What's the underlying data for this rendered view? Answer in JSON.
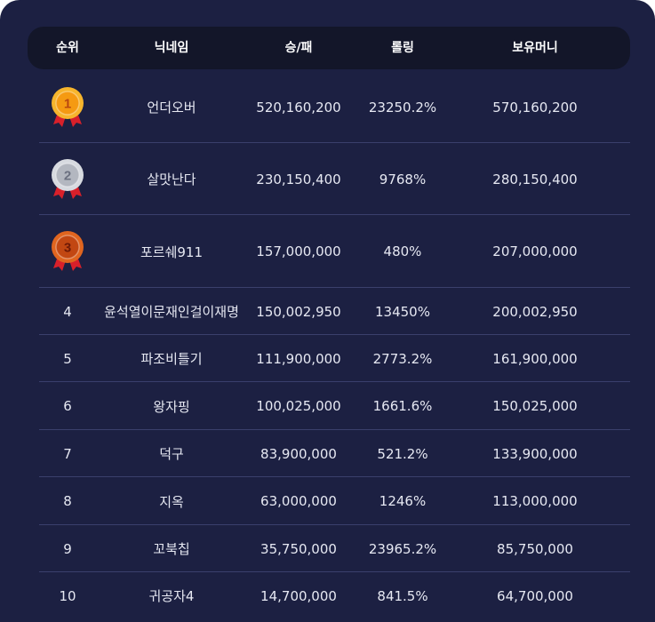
{
  "colors": {
    "panel": "#1c2042",
    "header": "#131629",
    "divider": "#3a3f6c",
    "text": "#e6e8f2",
    "gold": "#f5a623",
    "silver": "#c9ccd3",
    "bronze": "#d4561c",
    "ribbon": "#d8202a"
  },
  "table": {
    "headers": {
      "rank": "순위",
      "nickname": "닉네임",
      "win_loss": "승/패",
      "rolling": "롤링",
      "money": "보유머니"
    },
    "rows": [
      {
        "rank": "1",
        "medal": "gold-medal-icon",
        "nickname": "언더오버",
        "win_loss": "520,160,200",
        "rolling": "23250.2%",
        "money": "570,160,200"
      },
      {
        "rank": "2",
        "medal": "silver-medal-icon",
        "nickname": "살맛난다",
        "win_loss": "230,150,400",
        "rolling": "9768%",
        "money": "280,150,400"
      },
      {
        "rank": "3",
        "medal": "bronze-medal-icon",
        "nickname": "포르쉐911",
        "win_loss": "157,000,000",
        "rolling": "480%",
        "money": "207,000,000"
      },
      {
        "rank": "4",
        "nickname": "윤석열이문재인걸이재명",
        "win_loss": "150,002,950",
        "rolling": "13450%",
        "money": "200,002,950"
      },
      {
        "rank": "5",
        "nickname": "파조비틀기",
        "win_loss": "111,900,000",
        "rolling": "2773.2%",
        "money": "161,900,000"
      },
      {
        "rank": "6",
        "nickname": "왕자핑",
        "win_loss": "100,025,000",
        "rolling": "1661.6%",
        "money": "150,025,000"
      },
      {
        "rank": "7",
        "nickname": "덕구",
        "win_loss": "83,900,000",
        "rolling": "521.2%",
        "money": "133,900,000"
      },
      {
        "rank": "8",
        "nickname": "지옥",
        "win_loss": "63,000,000",
        "rolling": "1246%",
        "money": "113,000,000"
      },
      {
        "rank": "9",
        "nickname": "꼬북칩",
        "win_loss": "35,750,000",
        "rolling": "23965.2%",
        "money": "85,750,000"
      },
      {
        "rank": "10",
        "nickname": "귀공자4",
        "win_loss": "14,700,000",
        "rolling": "841.5%",
        "money": "64,700,000"
      }
    ]
  }
}
